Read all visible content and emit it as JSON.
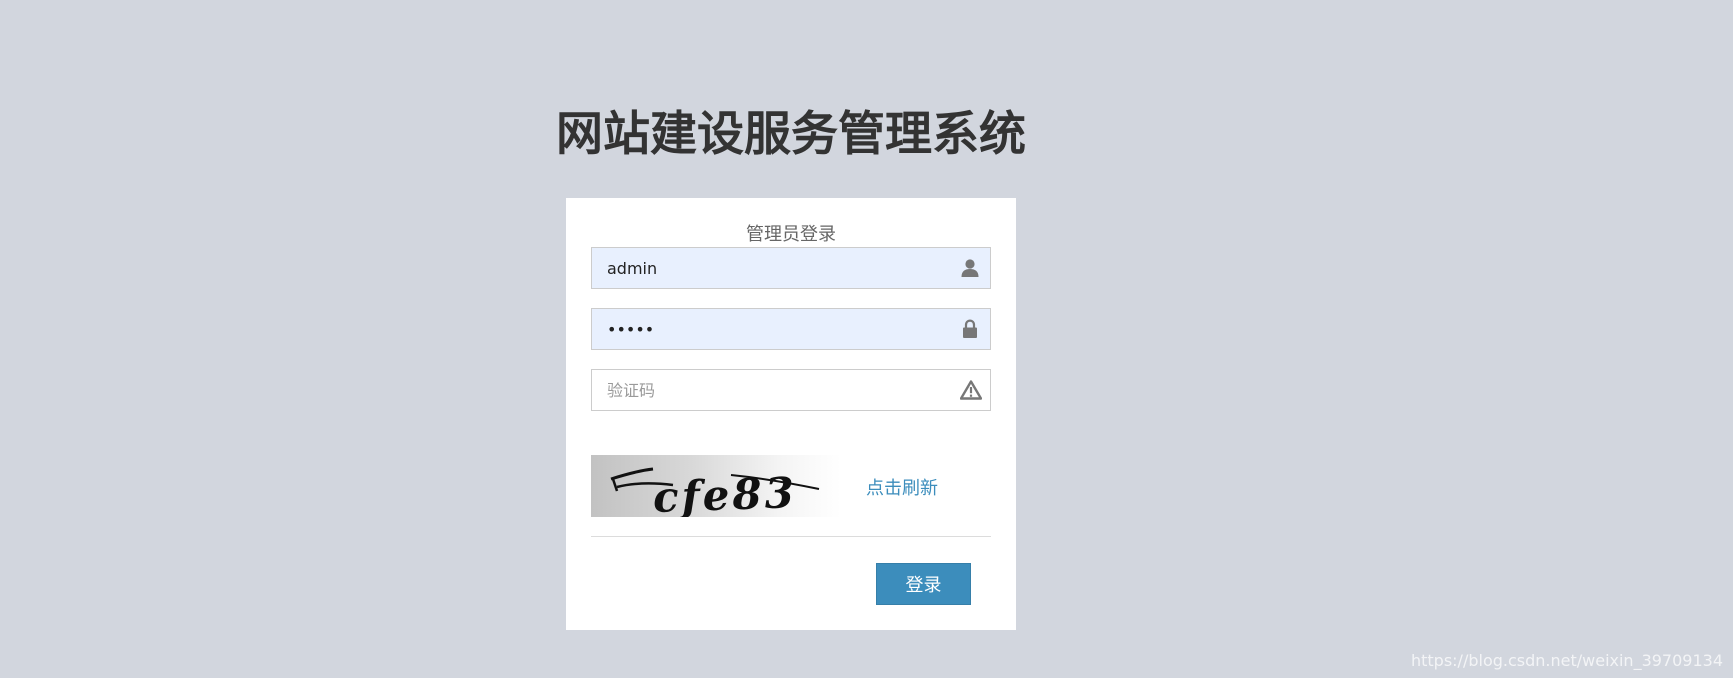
{
  "page": {
    "title": "网站建设服务管理系统"
  },
  "login": {
    "heading": "管理员登录",
    "username": {
      "value": "admin",
      "icon": "user-icon"
    },
    "password": {
      "value": "12345",
      "icon": "lock-icon"
    },
    "captcha_field": {
      "value": "",
      "placeholder": "验证码",
      "icon": "warning-icon"
    },
    "captcha_image": {
      "text": "cfe83"
    },
    "refresh_label": "点击刷新",
    "submit_label": "登录"
  },
  "watermark": "https://blog.csdn.net/weixin_39709134",
  "colors": {
    "background": "#d2d6de",
    "accent": "#3c8dbc",
    "autofill": "#e8f0fe"
  }
}
